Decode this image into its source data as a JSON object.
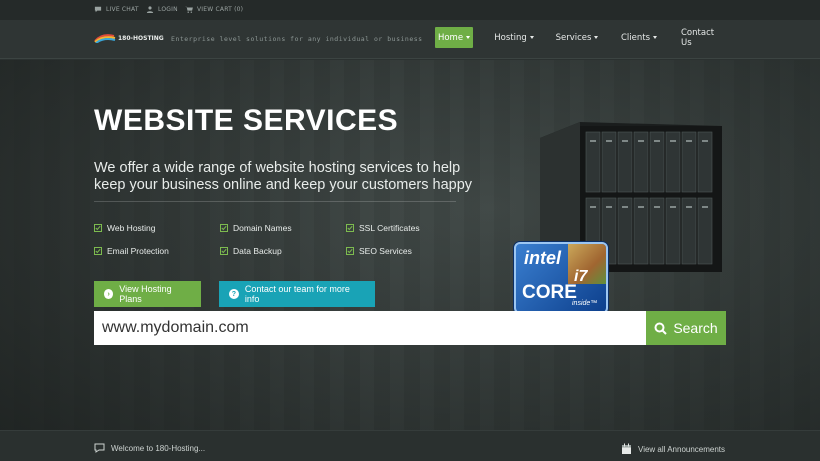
{
  "topbar": {
    "live_chat": "LIVE CHAT",
    "login": "LOGIN",
    "view_cart": "VIEW CART (0)"
  },
  "header": {
    "logo_text": "180-HOSTING",
    "tagline": "Enterprise level solutions for any individual or business",
    "nav": [
      {
        "label": "Home",
        "dropdown": true,
        "active": true
      },
      {
        "label": "Hosting",
        "dropdown": true,
        "active": false
      },
      {
        "label": "Services",
        "dropdown": true,
        "active": false
      },
      {
        "label": "Clients",
        "dropdown": true,
        "active": false
      },
      {
        "label": "Contact Us",
        "dropdown": false,
        "active": false
      }
    ]
  },
  "hero": {
    "title": "WEBSITE SERVICES",
    "subtitle": "We offer a wide range of website hosting services to help keep your business online and keep your customers happy",
    "features": [
      "Web Hosting",
      "Domain Names",
      "SSL Certificates",
      "Email Protection",
      "Data Backup",
      "SEO Services"
    ],
    "primary_button": "View Hosting Plans",
    "secondary_button": "Contact our team for more info",
    "badge": {
      "line1": "intel",
      "line2": "CORE",
      "line3": "i7",
      "line4": "inside™"
    },
    "slider": {
      "count": 3,
      "active_index": 0
    }
  },
  "search": {
    "value": "www.mydomain.com",
    "button": "Search"
  },
  "announcements": {
    "welcome": "Welcome to 180-Hosting...",
    "view_all": "View all Announcements"
  },
  "colors": {
    "accent_green": "#6fae46",
    "accent_teal": "#19a3b6",
    "topbar": "#252a29",
    "header": "#2f3534"
  }
}
